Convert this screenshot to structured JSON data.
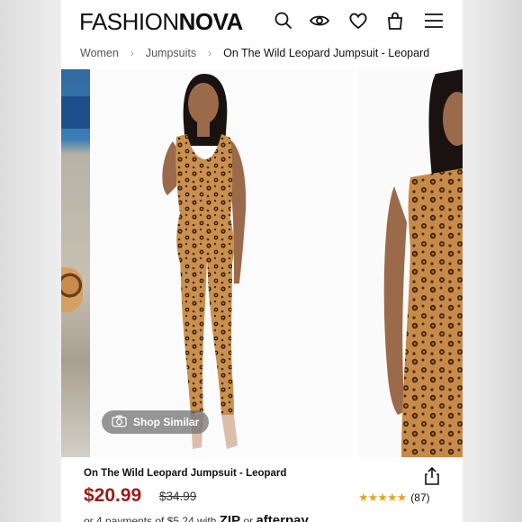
{
  "header": {
    "logo_thin": "FASHION",
    "logo_bold": "NOVA"
  },
  "breadcrumb": [
    "Women",
    "Jumpsuits",
    "On The Wild Leopard Jumpsuit - Leopard"
  ],
  "gallery": {
    "shop_similar_label": "Shop Similar"
  },
  "product": {
    "name": "On The Wild Leopard Jumpsuit - Leopard",
    "price": "$20.99",
    "original_price": "$34.99",
    "rating_stars": 5,
    "review_count": "(87)",
    "installments_prefix": "or 4 payments of $5.24 with",
    "zip_label": "ZIP",
    "or_label": "or",
    "afterpay_label": "afterpay"
  },
  "colors": {
    "price": "#9b1b1b",
    "stars": "#e2a722"
  },
  "icons": [
    "search-icon",
    "eye-icon",
    "heart-icon",
    "bag-icon",
    "menu-icon",
    "camera-icon",
    "share-icon"
  ]
}
